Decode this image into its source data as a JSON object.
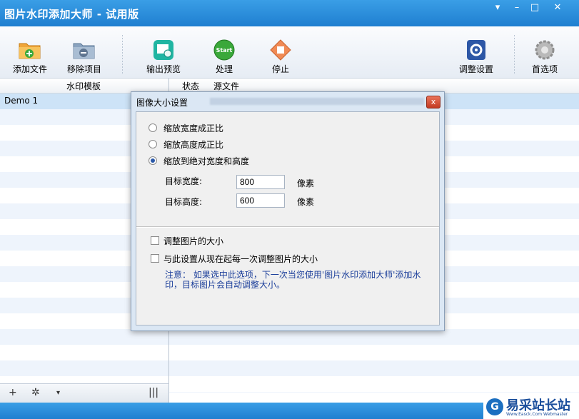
{
  "window": {
    "title": "图片水印添加大师 - 试用版"
  },
  "titlebar_buttons": [
    "▾",
    "–",
    "□",
    "✕"
  ],
  "toolbar": {
    "add_file": "添加文件",
    "remove_item": "移除项目",
    "output_preview": "输出预览",
    "process": "处理",
    "stop": "停止",
    "adjust_settings": "调整设置",
    "preferences": "首选项",
    "start_badge": "Start"
  },
  "left_list": {
    "header": "水印模板",
    "items": [
      "Demo 1"
    ]
  },
  "right_list": {
    "col_status": "状态",
    "col_source": "源文件"
  },
  "left_footer": {
    "add": "+",
    "gear": "✲",
    "dropdown": "▾",
    "columns": "|||"
  },
  "dialog": {
    "title": "图像大小设置",
    "close": "x",
    "options": [
      "缩放宽度成正比",
      "缩放高度成正比",
      "缩放到绝对宽度和高度"
    ],
    "selected_option": 2,
    "width_label": "目标宽度:",
    "width_value": "800",
    "height_label": "目标高度:",
    "height_value": "600",
    "unit": "像素",
    "resize_check": "调整图片的大小",
    "remember_check": "与此设置从现在起每一次调整图片的大小",
    "note": "注意：  如果选中此选项，下一次当您使用'图片水印添加大师'添加水印，目标图片会自动调整大小。"
  },
  "watermark": {
    "logo": "G",
    "name": "易采站长站",
    "sub": "Www.Easck.Com Webmaster"
  }
}
